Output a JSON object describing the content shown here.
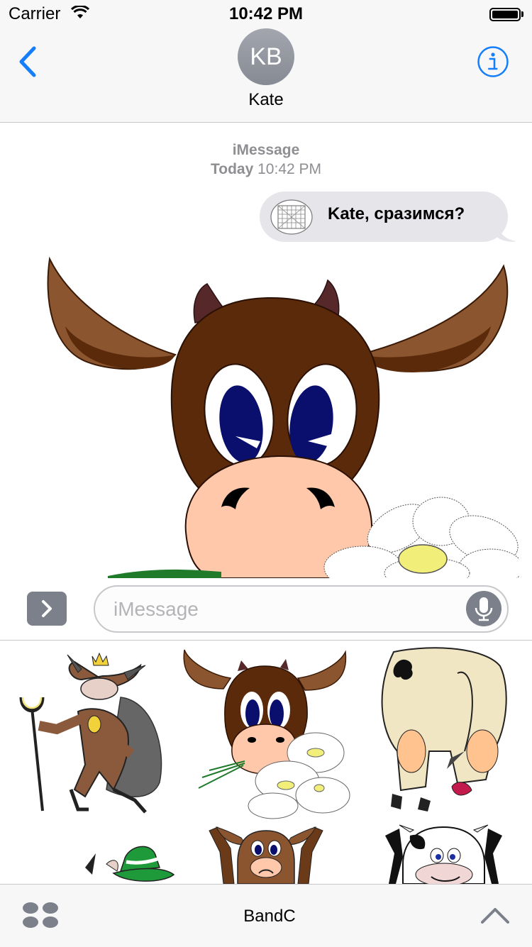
{
  "status_bar": {
    "carrier": "Carrier",
    "time": "10:42 PM"
  },
  "header": {
    "avatar_initials": "KB",
    "contact_name": "Kate"
  },
  "conversation": {
    "service": "iMessage",
    "timestamp_day": "Today",
    "timestamp_time": "10:42 PM",
    "message_text": "Kate, сразимся?"
  },
  "compose": {
    "placeholder": "iMessage"
  },
  "app_bar": {
    "app_name": "BandC"
  },
  "colors": {
    "accent": "#147efb",
    "bubble_gray": "#e5e5ea",
    "cow_brown": "#5a2a0a",
    "ear_brown": "#8b5530",
    "muzzle": "#ffc8ab",
    "eye_blue": "#0a0f6e",
    "daisy_center": "#f2ee7a"
  }
}
